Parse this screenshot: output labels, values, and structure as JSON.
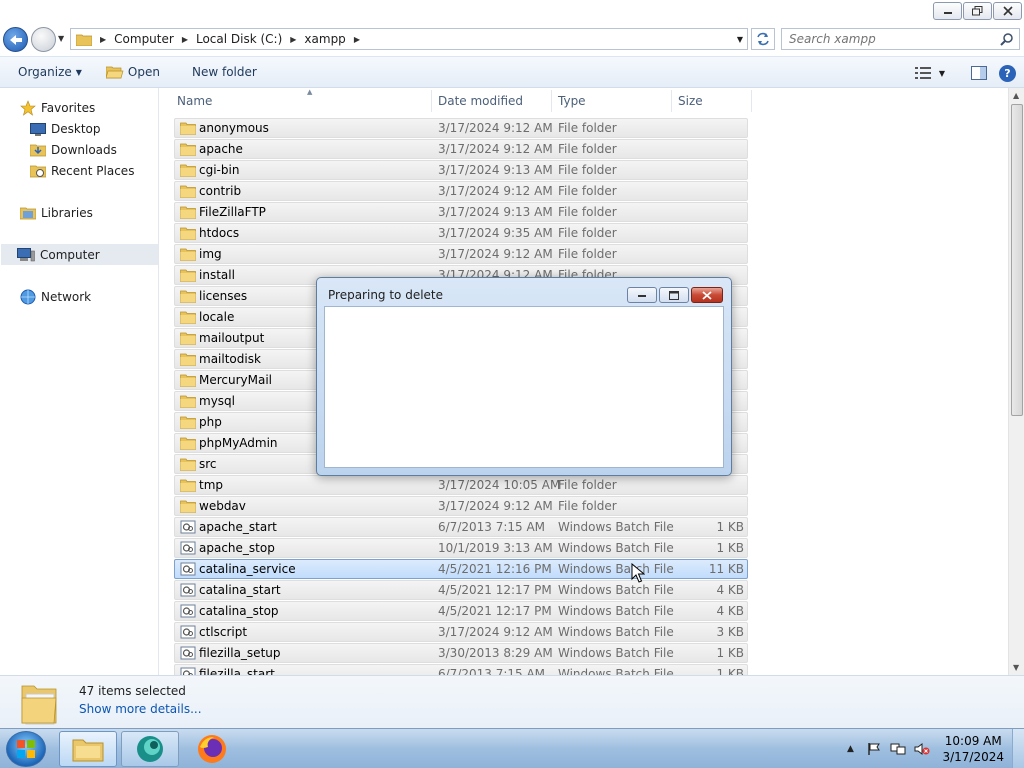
{
  "window": {
    "caption_buttons": [
      "minimize",
      "maximize",
      "close"
    ]
  },
  "address": {
    "crumbs": [
      "Computer",
      "Local Disk (C:)",
      "xampp"
    ],
    "search_placeholder": "Search xampp"
  },
  "toolbar": {
    "organize": "Organize",
    "open": "Open",
    "new_folder": "New folder"
  },
  "nav": {
    "favorites": "Favorites",
    "desktop": "Desktop",
    "downloads": "Downloads",
    "recent_places": "Recent Places",
    "libraries": "Libraries",
    "computer": "Computer",
    "network": "Network"
  },
  "columns": {
    "name": "Name",
    "date": "Date modified",
    "type": "Type",
    "size": "Size"
  },
  "files": [
    {
      "name": "anonymous",
      "date": "3/17/2024 9:12 AM",
      "type": "File folder",
      "size": "",
      "kind": "folder"
    },
    {
      "name": "apache",
      "date": "3/17/2024 9:12 AM",
      "type": "File folder",
      "size": "",
      "kind": "folder"
    },
    {
      "name": "cgi-bin",
      "date": "3/17/2024 9:13 AM",
      "type": "File folder",
      "size": "",
      "kind": "folder"
    },
    {
      "name": "contrib",
      "date": "3/17/2024 9:12 AM",
      "type": "File folder",
      "size": "",
      "kind": "folder"
    },
    {
      "name": "FileZillaFTP",
      "date": "3/17/2024 9:13 AM",
      "type": "File folder",
      "size": "",
      "kind": "folder"
    },
    {
      "name": "htdocs",
      "date": "3/17/2024 9:35 AM",
      "type": "File folder",
      "size": "",
      "kind": "folder"
    },
    {
      "name": "img",
      "date": "3/17/2024 9:12 AM",
      "type": "File folder",
      "size": "",
      "kind": "folder"
    },
    {
      "name": "install",
      "date": "3/17/2024 9:12 AM",
      "type": "File folder",
      "size": "",
      "kind": "folder"
    },
    {
      "name": "licenses",
      "date": "",
      "type": "",
      "size": "",
      "kind": "folder"
    },
    {
      "name": "locale",
      "date": "",
      "type": "",
      "size": "",
      "kind": "folder"
    },
    {
      "name": "mailoutput",
      "date": "",
      "type": "",
      "size": "",
      "kind": "folder"
    },
    {
      "name": "mailtodisk",
      "date": "",
      "type": "",
      "size": "",
      "kind": "folder"
    },
    {
      "name": "MercuryMail",
      "date": "",
      "type": "",
      "size": "",
      "kind": "folder"
    },
    {
      "name": "mysql",
      "date": "",
      "type": "",
      "size": "",
      "kind": "folder"
    },
    {
      "name": "php",
      "date": "",
      "type": "",
      "size": "",
      "kind": "folder"
    },
    {
      "name": "phpMyAdmin",
      "date": "",
      "type": "",
      "size": "",
      "kind": "folder"
    },
    {
      "name": "src",
      "date": "",
      "type": "",
      "size": "",
      "kind": "folder"
    },
    {
      "name": "tmp",
      "date": "3/17/2024 10:05 AM",
      "type": "File folder",
      "size": "",
      "kind": "folder"
    },
    {
      "name": "webdav",
      "date": "3/17/2024 9:12 AM",
      "type": "File folder",
      "size": "",
      "kind": "folder"
    },
    {
      "name": "apache_start",
      "date": "6/7/2013 7:15 AM",
      "type": "Windows Batch File",
      "size": "1 KB",
      "kind": "batch"
    },
    {
      "name": "apache_stop",
      "date": "10/1/2019 3:13 AM",
      "type": "Windows Batch File",
      "size": "1 KB",
      "kind": "batch"
    },
    {
      "name": "catalina_service",
      "date": "4/5/2021 12:16 PM",
      "type": "Windows Batch File",
      "size": "11 KB",
      "kind": "batch",
      "focus": true
    },
    {
      "name": "catalina_start",
      "date": "4/5/2021 12:17 PM",
      "type": "Windows Batch File",
      "size": "4 KB",
      "kind": "batch"
    },
    {
      "name": "catalina_stop",
      "date": "4/5/2021 12:17 PM",
      "type": "Windows Batch File",
      "size": "4 KB",
      "kind": "batch"
    },
    {
      "name": "ctlscript",
      "date": "3/17/2024 9:12 AM",
      "type": "Windows Batch File",
      "size": "3 KB",
      "kind": "batch"
    },
    {
      "name": "filezilla_setup",
      "date": "3/30/2013 8:29 AM",
      "type": "Windows Batch File",
      "size": "1 KB",
      "kind": "batch"
    },
    {
      "name": "filezilla_start",
      "date": "6/7/2013 7:15 AM",
      "type": "Windows Batch File",
      "size": "1 KB",
      "kind": "batch"
    }
  ],
  "details": {
    "count": "47 items selected",
    "more": "Show more details..."
  },
  "dialog": {
    "title": "Preparing to delete"
  },
  "taskbar": {
    "time": "10:09 AM",
    "date": "3/17/2024"
  },
  "colors": {
    "selection": "#c1dcfc",
    "row_selected": "#e7e7e7",
    "link": "#0b56b4",
    "close_red": "#c84a35"
  }
}
